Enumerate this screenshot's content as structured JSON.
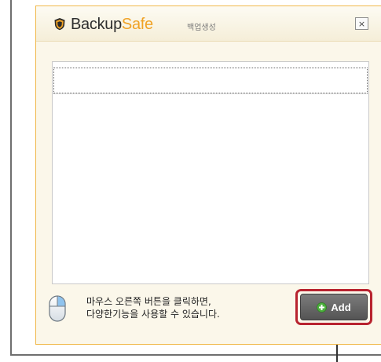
{
  "dialog": {
    "brand_backup": "Backup",
    "brand_safe": "Safe",
    "subtitle": "백업생성",
    "close_label": "×"
  },
  "footer": {
    "hint_line1": "마우스 오른쪽 버튼을 클릭하면,",
    "hint_line2": "다양한기능을 사용할 수 있습니다.",
    "add_label": "Add"
  },
  "colors": {
    "brand_orange": "#f0a225",
    "dialog_border": "#f0b84a",
    "highlight_red": "#b8232f",
    "button_gray": "#666666"
  },
  "icons": [
    "shield-logo-icon",
    "close-icon",
    "mouse-icon",
    "plus-icon"
  ]
}
